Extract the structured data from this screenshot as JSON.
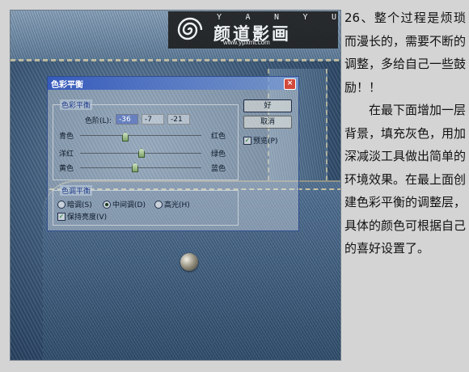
{
  "watermark": {
    "letters": [
      "Y",
      "A",
      "N",
      "Y",
      "U"
    ],
    "chinese": "颜道影画",
    "url": "www.ypxmt.com"
  },
  "dialog": {
    "title": "色彩平衡",
    "close_label": "×",
    "color_balance": {
      "group_label": "色彩平衡",
      "levels_label": "色阶(L):",
      "levels": [
        "-36",
        "-7",
        "-21"
      ],
      "sliders": [
        {
          "left": "青色",
          "right": "红色",
          "value": -36
        },
        {
          "left": "洋红",
          "right": "绿色",
          "value": -7
        },
        {
          "left": "黄色",
          "right": "蓝色",
          "value": -21
        }
      ]
    },
    "tone_balance": {
      "group_label": "色调平衡",
      "options": [
        "暗调(S)",
        "中间调(D)",
        "高光(H)"
      ],
      "selected": "中间调(D)",
      "preserve_label": "保持亮度(V)",
      "preserve_checked": true
    },
    "ok_label": "好",
    "cancel_label": "取消",
    "preview_label": "预览(P)",
    "preview_checked": true
  },
  "article": {
    "para1": "26、整个过程是烦琐而漫长的，需要不断的调整，多给自己一些鼓励！！",
    "para2": "在最下面增加一层背景，填充灰色，用加深减淡工具做出简单的环境效果。在最上面创建色彩平衡的调整层，具体的颜色可根据自己的喜好设置了。"
  }
}
